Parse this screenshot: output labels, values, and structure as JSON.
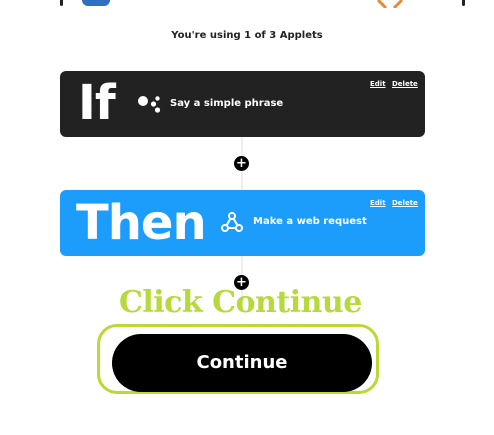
{
  "usage": {
    "text": "You're using 1 of 3 Applets"
  },
  "if_card": {
    "keyword": "If",
    "icon": "google-assistant-icon",
    "action": "Say a simple phrase",
    "edit_label": "Edit",
    "delete_label": "Delete",
    "color": "#222222"
  },
  "connectors": {
    "plus_symbol": "+"
  },
  "then_card": {
    "keyword": "Then",
    "icon": "webhooks-icon",
    "action": "Make a web request",
    "edit_label": "Edit",
    "delete_label": "Delete",
    "color": "#1c9dfb"
  },
  "annotation": {
    "text": "Click Continue",
    "color": "#b6d93b"
  },
  "continue_button": {
    "label": "Continue"
  }
}
